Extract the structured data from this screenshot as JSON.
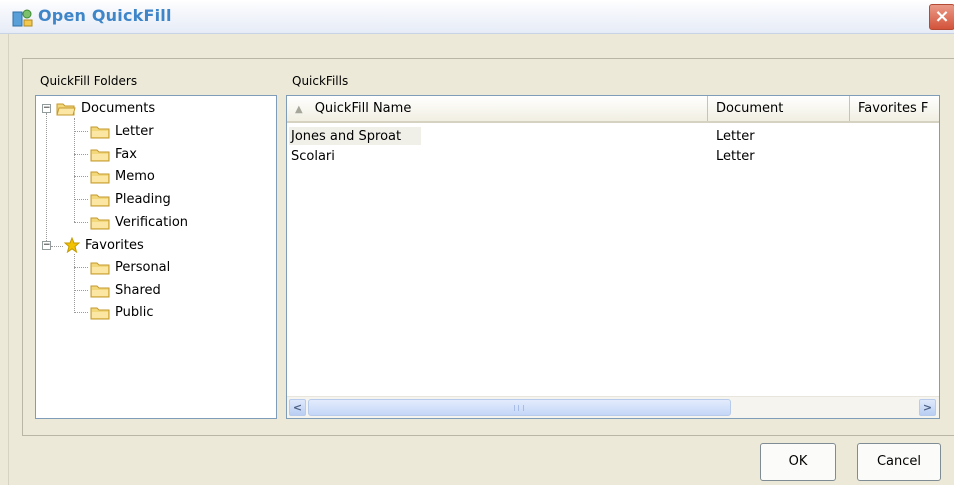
{
  "window": {
    "title": "Open QuickFill",
    "close_label": "×"
  },
  "folders_panel": {
    "label": "QuickFill Folders",
    "tree": [
      {
        "label": "Documents",
        "expanded": true,
        "expander": "−",
        "icon": "folder-open-icon",
        "children": [
          "Letter",
          "Fax",
          "Memo",
          "Pleading",
          "Verification"
        ]
      },
      {
        "label": "Favorites",
        "expanded": true,
        "expander": "−",
        "icon": "star-icon",
        "children": [
          "Personal",
          "Shared",
          "Public"
        ]
      }
    ]
  },
  "quickfills_panel": {
    "label": "QuickFills",
    "sort_indicator": "▲",
    "columns": [
      "QuickFill Name",
      "Document",
      "Favorites F"
    ],
    "rows": [
      {
        "name": "Jones and Sproat",
        "document": "Letter"
      },
      {
        "name": "Scolari",
        "document": "Letter"
      }
    ],
    "scroll_left": "<",
    "scroll_right": ">"
  },
  "buttons": {
    "ok": "OK",
    "cancel": "Cancel"
  },
  "colors": {
    "title_text": "#3f86c9",
    "close_button": "#d3533a",
    "folder": "#f3d77b",
    "star": "#f2c200"
  }
}
